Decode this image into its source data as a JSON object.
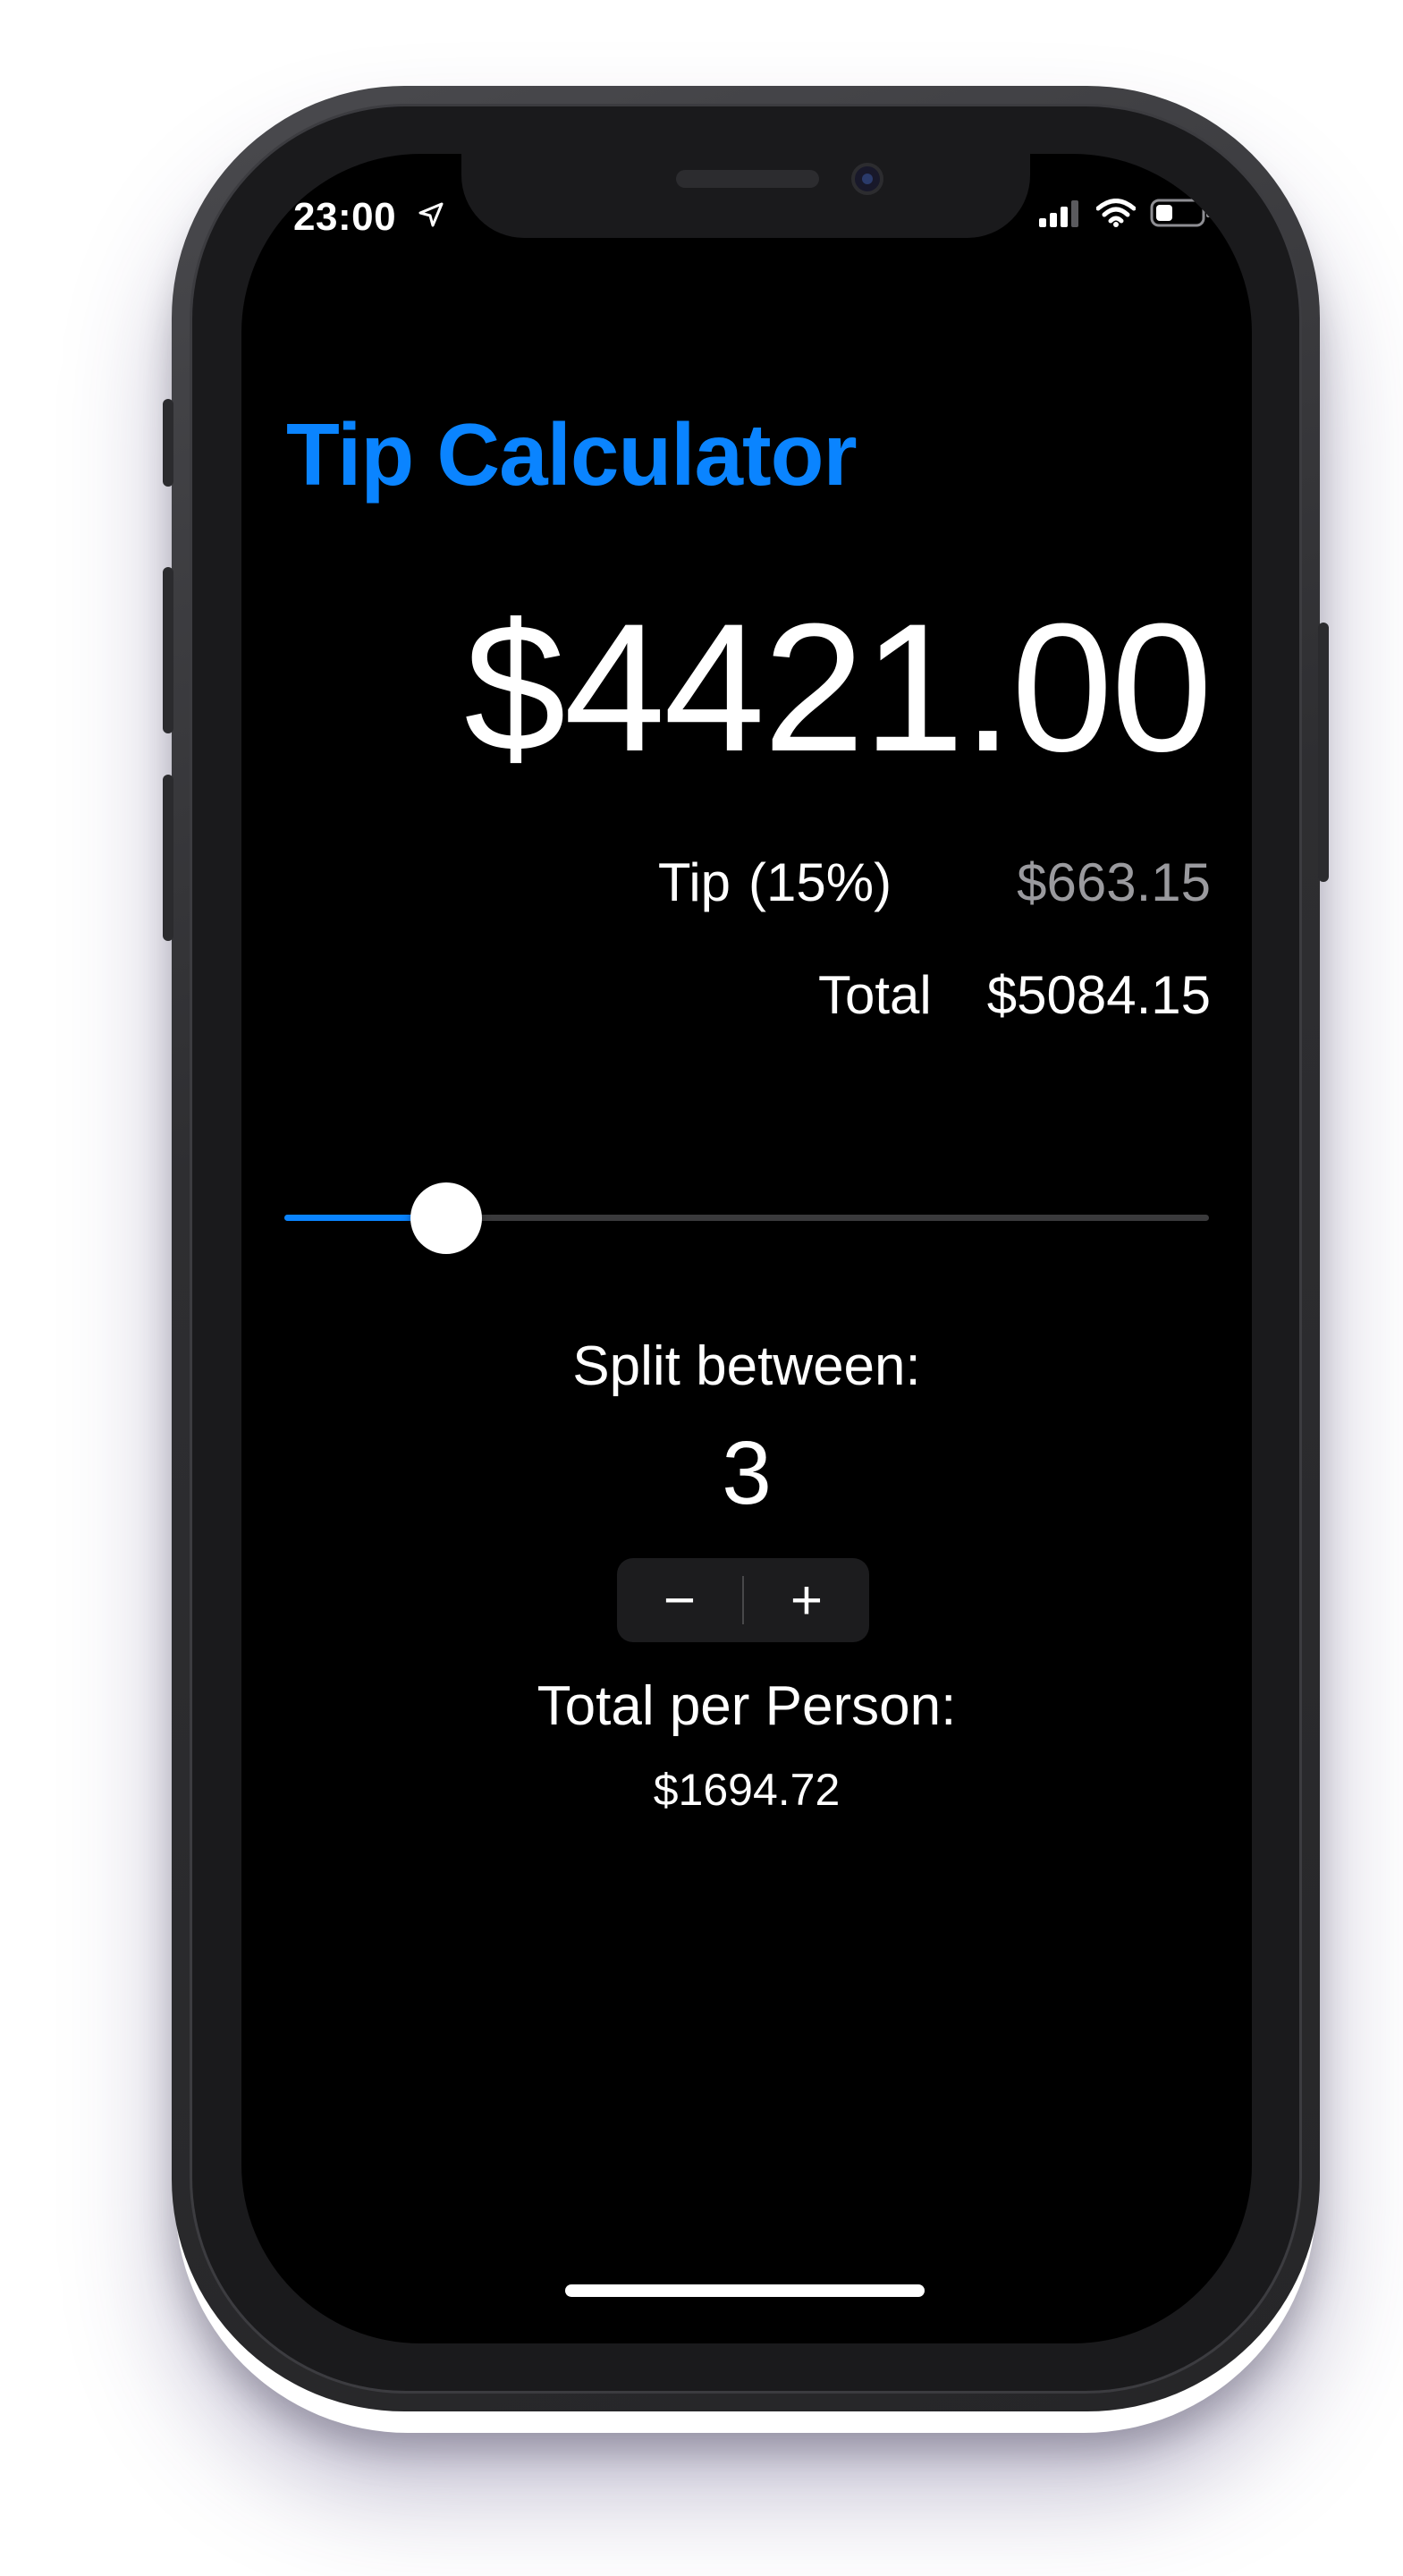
{
  "status_bar": {
    "time": "23:00",
    "location_icon": "location-arrow-icon",
    "signal_icon": "cellular-signal-icon",
    "wifi_icon": "wifi-icon",
    "battery_icon": "battery-icon"
  },
  "app": {
    "title": "Tip Calculator",
    "bill_amount": "$4421.00",
    "tip": {
      "label": "Tip",
      "percent_text": "(15%)",
      "value": "$663.15"
    },
    "total": {
      "label": "Total",
      "value": "$5084.15"
    },
    "slider": {
      "value_fraction": 0.175
    },
    "split": {
      "label": "Split between:",
      "count": "3",
      "decrement_label": "−",
      "increment_label": "+"
    },
    "per_person": {
      "label": "Total per Person:",
      "value": "$1694.72"
    }
  },
  "colors": {
    "accent": "#0a84ff",
    "background": "#000000",
    "text": "#ffffff",
    "secondary_text": "#9a9a9e"
  }
}
